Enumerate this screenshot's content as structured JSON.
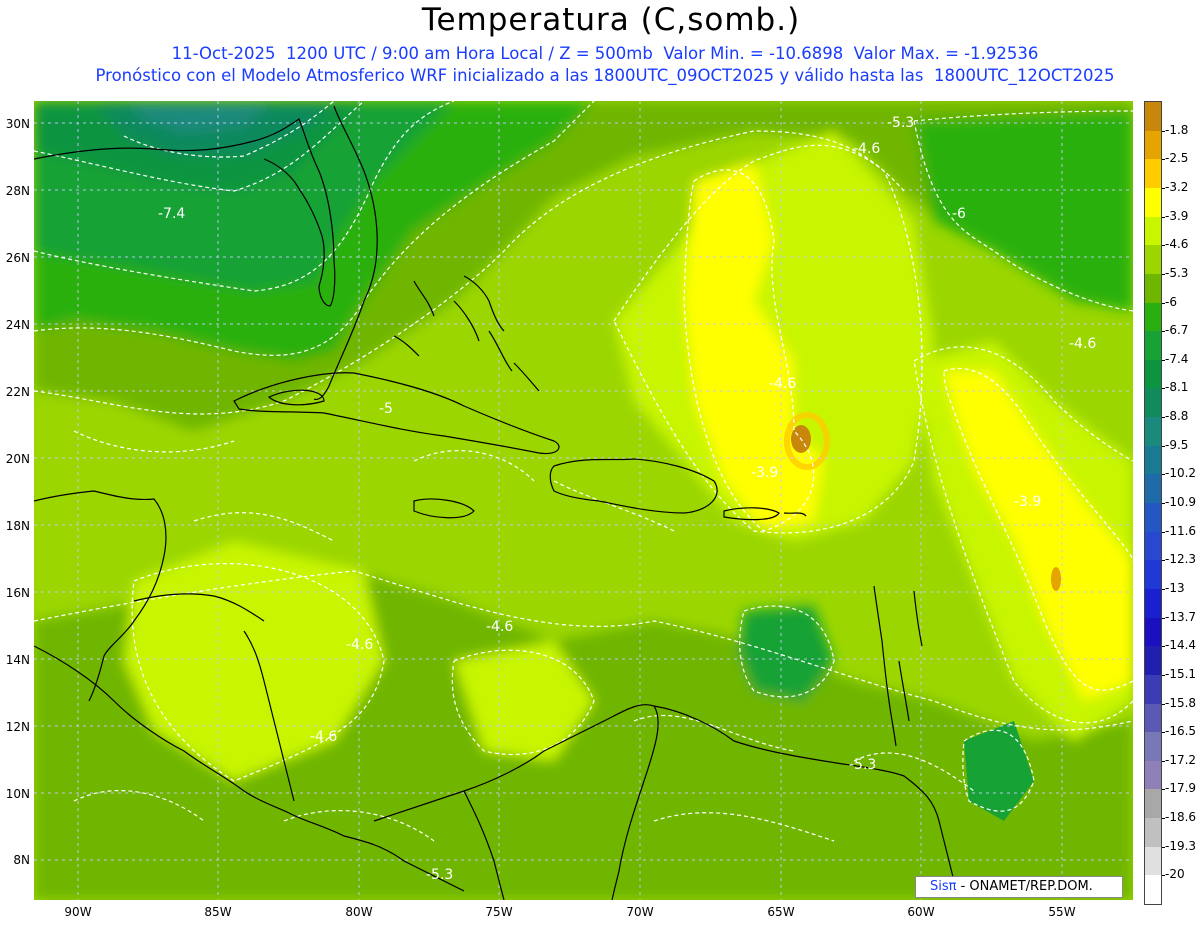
{
  "title": "Temperatura (C,somb.)",
  "subtitle_line1": "11-Oct-2025  1200 UTC / 9:00 am Hora Local / Z = 500mb  Valor Min. = -10.6898  Valor Max. = -1.92536",
  "subtitle_line2": "Pronóstico con el Modelo Atmosferico WRF inicializado a las 1800UTC_09OCT2025 y válido hasta las  1800UTC_12OCT2025",
  "credit": {
    "brand": "Sisπ",
    "text": " - ONAMET/REP.DOM."
  },
  "map": {
    "lon_range": [
      -91.5,
      -52.5
    ],
    "lat_range": [
      7,
      30.8
    ],
    "x_ticks": [
      "90W",
      "85W",
      "80W",
      "75W",
      "70W",
      "65W",
      "60W",
      "55W"
    ],
    "y_ticks": [
      "30N",
      "28N",
      "26N",
      "24N",
      "22N",
      "20N",
      "18N",
      "16N",
      "14N",
      "12N",
      "10N",
      "8N"
    ],
    "contour_labels": [
      "-5.3",
      "-4.6",
      "-7.4",
      "-6",
      "-4.6",
      "-5",
      "-4.6",
      "-3.9",
      "-3.9",
      "-4.6",
      "-4.6",
      "-4.6",
      "-5.3",
      "-5.3"
    ]
  },
  "colorbar": {
    "labels": [
      "-1.8",
      "-2.5",
      "-3.2",
      "-3.9",
      "-4.6",
      "-5.3",
      "-6",
      "-6.7",
      "-7.4",
      "-8.1",
      "-8.8",
      "-9.5",
      "-10.2",
      "-10.9",
      "-11.6",
      "-12.3",
      "-13",
      "-13.7",
      "-14.4",
      "-15.1",
      "-15.8",
      "-16.5",
      "-17.2",
      "-17.9",
      "-18.6",
      "-19.3",
      "-20"
    ],
    "colors": [
      "#c8860a",
      "#e5a400",
      "#ffcc00",
      "#ffff00",
      "#c8f500",
      "#9bd600",
      "#6fb600",
      "#29b010",
      "#16a235",
      "#0c9440",
      "#118a5c",
      "#1a8a7c",
      "#1a7a92",
      "#1f6aa8",
      "#2456c4",
      "#2848d0",
      "#2038d6",
      "#1a20d0",
      "#1a10c0",
      "#2020b0",
      "#3c3cb4",
      "#5a5ab4",
      "#7878b8",
      "#9080b8",
      "#a8a8a8",
      "#c0c0c0",
      "#e0e0e0",
      "#ffffff"
    ]
  }
}
